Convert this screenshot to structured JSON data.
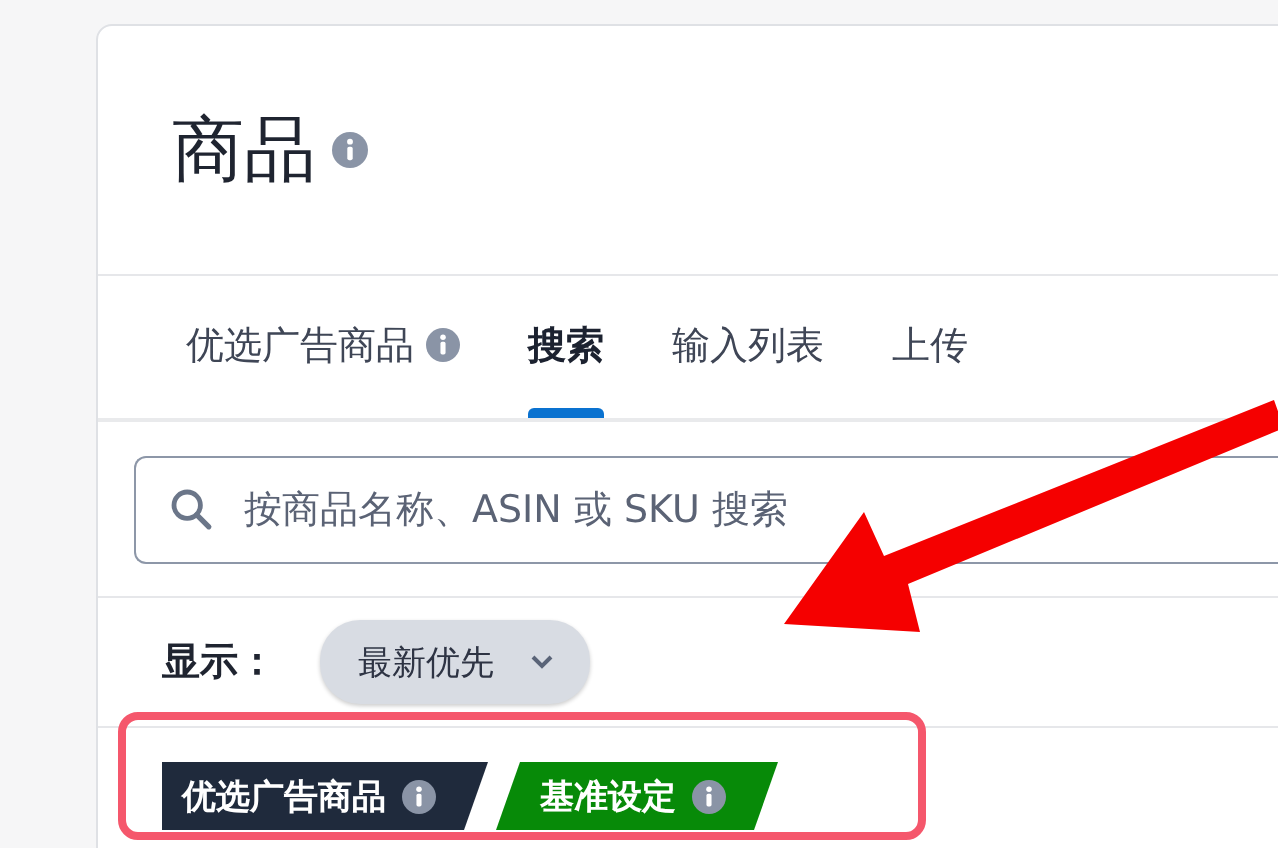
{
  "title": "商品",
  "tabs": [
    {
      "label": "优选广告商品",
      "info": true,
      "selected": false
    },
    {
      "label": "搜索",
      "info": false,
      "selected": true
    },
    {
      "label": "输入列表",
      "info": false,
      "selected": false
    },
    {
      "label": "上传",
      "info": false,
      "selected": false
    }
  ],
  "search": {
    "placeholder": "按商品名称、ASIN 或 SKU 搜索"
  },
  "sort": {
    "label": "显示：",
    "value": "最新优先"
  },
  "tags": [
    {
      "label": "优选广告商品",
      "color": "#1f2a3c"
    },
    {
      "label": "基准设定",
      "color": "#078a08"
    }
  ]
}
